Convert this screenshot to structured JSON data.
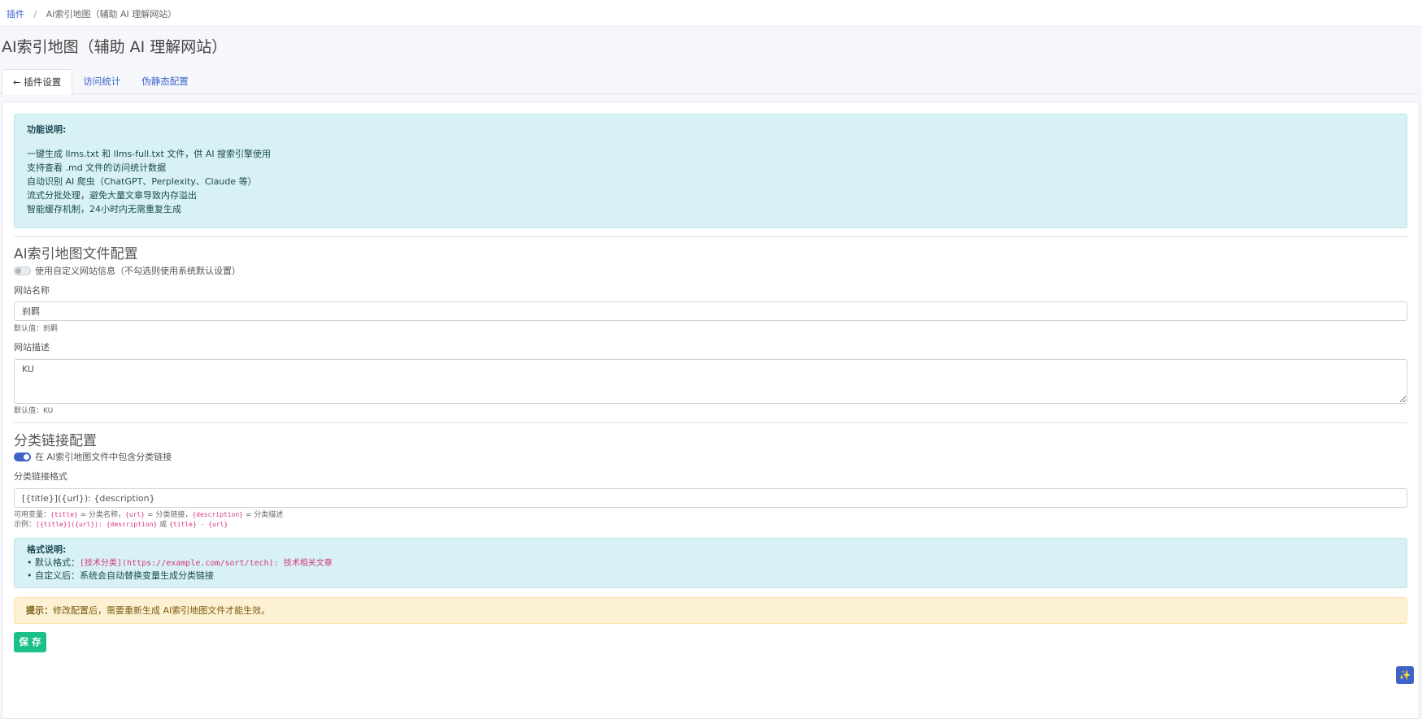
{
  "breadcrumb": {
    "root": "插件",
    "separator": "/",
    "current": "AI索引地图（辅助 AI 理解网站）"
  },
  "page_title": "AI索引地图（辅助 AI 理解网站）",
  "tabs": [
    {
      "label": "← 插件设置",
      "active": true
    },
    {
      "label": "访问统计",
      "active": false
    },
    {
      "label": "伪静态配置",
      "active": false
    }
  ],
  "feature_info": {
    "heading": "功能说明:",
    "lines": [
      "一键生成 llms.txt 和 llms-full.txt 文件，供 AI 搜索引擎使用",
      "支持查看 .md 文件的访问统计数据",
      "自动识别 AI 爬虫（ChatGPT、Perplexity、Claude 等）",
      "流式分批处理，避免大量文章导致内存溢出",
      "智能缓存机制，24小时内无需重复生成"
    ]
  },
  "file_config": {
    "title": "AI索引地图文件配置",
    "custom_toggle_label": "使用自定义网站信息（不勾选则使用系统默认设置）",
    "custom_toggle_on": false,
    "site_name_label": "网站名称",
    "site_name_value": "刹羁",
    "site_name_default": "默认值：刹羁",
    "site_desc_label": "网站描述",
    "site_desc_value": "KU",
    "site_desc_default": "默认值：KU"
  },
  "category_config": {
    "title": "分类链接配置",
    "include_toggle_label": "在 AI索引地图文件中包含分类链接",
    "include_toggle_on": true,
    "format_label": "分类链接格式",
    "format_value": "[{title}]({url}): {description}",
    "vars_prefix": "可用变量：",
    "var_title": "{title}",
    "var_title_desc": " = 分类名称，",
    "var_url": "{url}",
    "var_url_desc": " = 分类链接，",
    "var_desc": "{description}",
    "var_desc_desc": " = 分类描述",
    "example_prefix": "示例：",
    "example_1": "[{title}]({url}): {description}",
    "example_or": " 或 ",
    "example_2": "{title} - {url}"
  },
  "format_info": {
    "heading": "格式说明:",
    "default_prefix": "• 默认格式：",
    "default_code": "[技术分类](https://example.com/sort/tech): 技术相关文章",
    "custom_line": "• 自定义后：系统会自动替换变量生成分类链接"
  },
  "warning": {
    "prefix": "提示：",
    "text": "修改配置后，需要重新生成 AI索引地图文件才能生效。"
  },
  "save_label": "保 存",
  "floating_icon": "sparkle-icon",
  "colors": {
    "link": "#3d63c9",
    "save": "#1bc088",
    "info_bg": "#d7f1f4",
    "warn_bg": "#fdf1d3",
    "code": "#d63384"
  }
}
